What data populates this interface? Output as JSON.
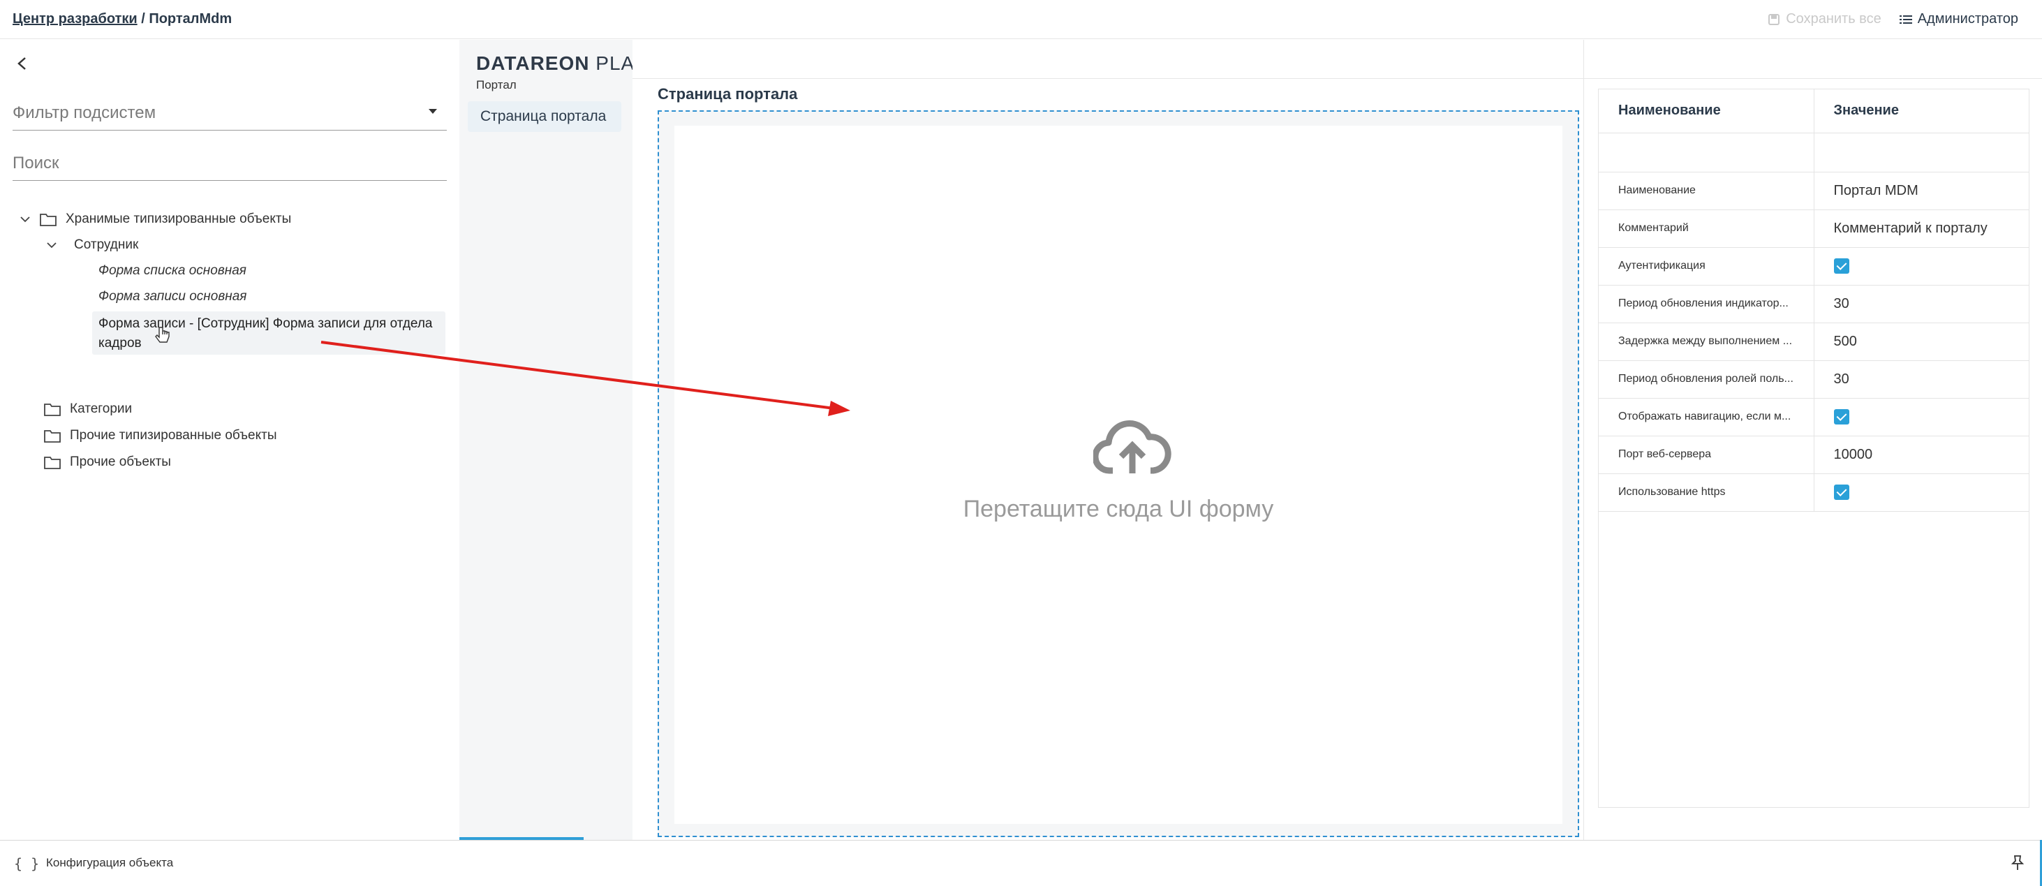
{
  "breadcrumb": {
    "link": "Центр разработки",
    "separator": " / ",
    "current": "ПорталMdm"
  },
  "top_actions": {
    "save_all": "Сохранить все",
    "user": "Администратор"
  },
  "left": {
    "filter_placeholder": "Фильтр подсистем",
    "search_placeholder": "Поиск",
    "tree": {
      "stored_objects": "Хранимые типизированные объекты",
      "employee": "Сотрудник",
      "list_form": "Форма списка основная",
      "record_form": "Форма записи основная",
      "selected_form": "Форма записи - [Сотрудник] Форма записи для отдела кадров",
      "categories": "Категории",
      "other_typed": "Прочие типизированные объекты",
      "other_objects": "Прочие объекты"
    }
  },
  "nav": {
    "logo_bold": "DATAREON",
    "logo_light": " PLA",
    "subtitle": "Портал",
    "item": "Страница портала"
  },
  "center": {
    "title": "Страница портала",
    "drop_text": "Перетащите сюда UI форму"
  },
  "properties": {
    "header_name": "Наименование",
    "header_value": "Значение",
    "rows": [
      {
        "name": "Наименование",
        "value": "Портал MDM"
      },
      {
        "name": "Комментарий",
        "value": "Комментарий к порталу"
      },
      {
        "name": "Аутентификация",
        "value": ""
      },
      {
        "name": "Период обновления индикатор...",
        "value": "30"
      },
      {
        "name": "Задержка между выполнением ...",
        "value": "500"
      },
      {
        "name": "Период обновления ролей поль...",
        "value": "30"
      },
      {
        "name": "Отображать навигацию, если м...",
        "value": ""
      },
      {
        "name": "Порт веб-сервера",
        "value": "10000"
      },
      {
        "name": "Использование https",
        "value": ""
      }
    ],
    "checked": {
      "auth": true,
      "navigation": true,
      "https": true
    }
  },
  "bottom": {
    "config_label": "Конфигурация объекта"
  },
  "colors": {
    "accent": "#2aa0d8",
    "arrow": "#e0201c",
    "dropzone_border": "#2f8fd0"
  }
}
